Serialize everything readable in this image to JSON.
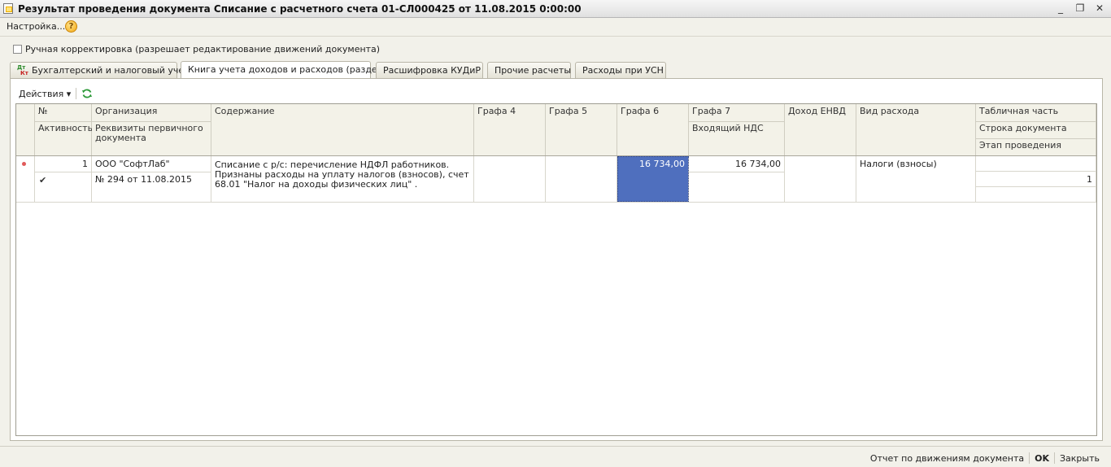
{
  "window": {
    "title": "Результат проведения документа Списание с расчетного счета 01-СЛ000425 от 11.08.2015 0:00:00",
    "minimize_glyph": "_",
    "restore_glyph": "❐",
    "close_glyph": "✕"
  },
  "menu": {
    "settings_label": "Настройка...",
    "help_glyph": "?"
  },
  "manual_edit_label": "Ручная корректировка (разрешает редактирование движений документа)",
  "tabs": [
    {
      "label": "Бухгалтерский и налоговый учет",
      "icon_top": "Дт",
      "icon_bottom": "Кт"
    },
    {
      "label": "Книга учета доходов и расходов (раздел I)"
    },
    {
      "label": "Расшифровка КУДиР"
    },
    {
      "label": "Прочие расчеты"
    },
    {
      "label": "Расходы при УСН"
    }
  ],
  "toolbar": {
    "actions_label": "Действия ▾"
  },
  "columns": {
    "num": "№",
    "active": "Активность",
    "org": "Организация",
    "primary": "Реквизиты первичного документа",
    "content": "Содержание",
    "g4": "Графа 4",
    "g5": "Графа 5",
    "g6": "Графа 6",
    "g7": "Графа 7",
    "vat": "Входящий НДС",
    "envd": "Доход ЕНВД",
    "exp": "Вид расхода",
    "tab": "Табличная часть",
    "docline": "Строка документа",
    "stage": "Этап проведения"
  },
  "row": {
    "num": "1",
    "active_glyph": "✔",
    "org": "ООО \"СофтЛаб\"",
    "primary": "№ 294 от 11.08.2015",
    "content": "Списание с р/с: перечисление НДФЛ работников. Признаны расходы на уплату налогов (взносов),  счет 68.01 \"Налог на доходы физических лиц\" .",
    "g6": "16 734,00",
    "g7": "16 734,00",
    "exp": "Налоги (взносы)",
    "docline": "1"
  },
  "footer": {
    "report_label": "Отчет по движениям документа",
    "ok_label": "OK",
    "close_label": "Закрыть"
  }
}
